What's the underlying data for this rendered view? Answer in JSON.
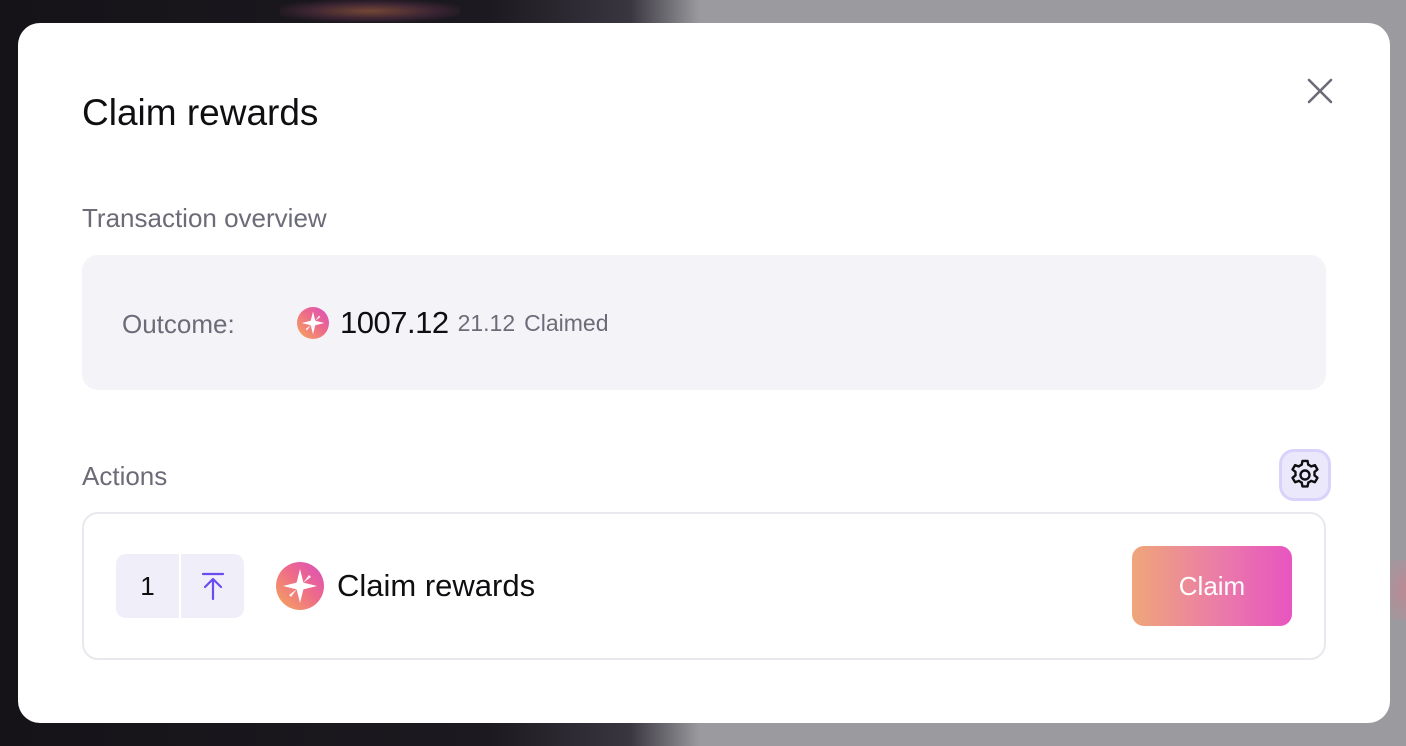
{
  "modal": {
    "title": "Claim rewards"
  },
  "overview": {
    "heading": "Transaction overview",
    "outcome_label": "Outcome:",
    "amount": "1007.12",
    "sub_amount": "21.12",
    "status": "Claimed",
    "token_icon": "sparkle-token-icon"
  },
  "actions": {
    "heading": "Actions",
    "steps": [
      {
        "number": "1",
        "direction_icon": "arrow-up-to-line-icon",
        "token_icon": "sparkle-token-icon",
        "label": "Claim rewards",
        "button_label": "Claim"
      }
    ]
  },
  "colors": {
    "accent_gradient_start": "#efa679",
    "accent_gradient_end": "#e855c1",
    "arrow_color": "#6a4cf0",
    "settings_ring": "#d9d3fb"
  }
}
